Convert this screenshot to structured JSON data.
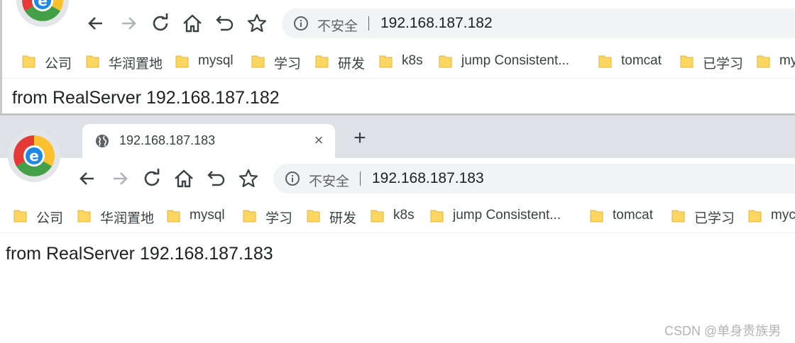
{
  "windows": [
    {
      "omnibox": {
        "security_label": "不安全",
        "url": "192.168.187.182"
      },
      "bookmarks": [
        "公司",
        "华润置地",
        "mysql",
        "学习",
        "研发",
        "k8s",
        "jump Consistent...",
        "tomcat",
        "已学习",
        "my"
      ],
      "content": {
        "text": "from RealServer 192.168.187.182"
      }
    },
    {
      "tab": {
        "title": "192.168.187.183",
        "close_glyph": "×",
        "newtab_glyph": "+"
      },
      "omnibox": {
        "security_label": "不安全",
        "url": "192.168.187.183"
      },
      "bookmarks": [
        "公司",
        "华润置地",
        "mysql",
        "学习",
        "研发",
        "k8s",
        "jump Consistent...",
        "tomcat",
        "已学习",
        "myc"
      ],
      "content": {
        "text": "from RealServer 192.168.187.183"
      }
    }
  ],
  "icons": {
    "browser_logo": "chrome-e-logo",
    "back": "arrow-left-icon",
    "forward": "arrow-right-icon",
    "reload": "reload-icon",
    "home": "home-icon",
    "undo": "undo-icon",
    "star": "star-icon",
    "info": "info-icon",
    "folder": "folder-icon",
    "globe": "globe-icon"
  },
  "colors": {
    "tabstrip": "#dee1e6",
    "omnibox": "#f1f3f4",
    "folder": "#fcd661",
    "forward_disabled": "#b0b3b8"
  },
  "watermark": "CSDN @单身贵族男"
}
